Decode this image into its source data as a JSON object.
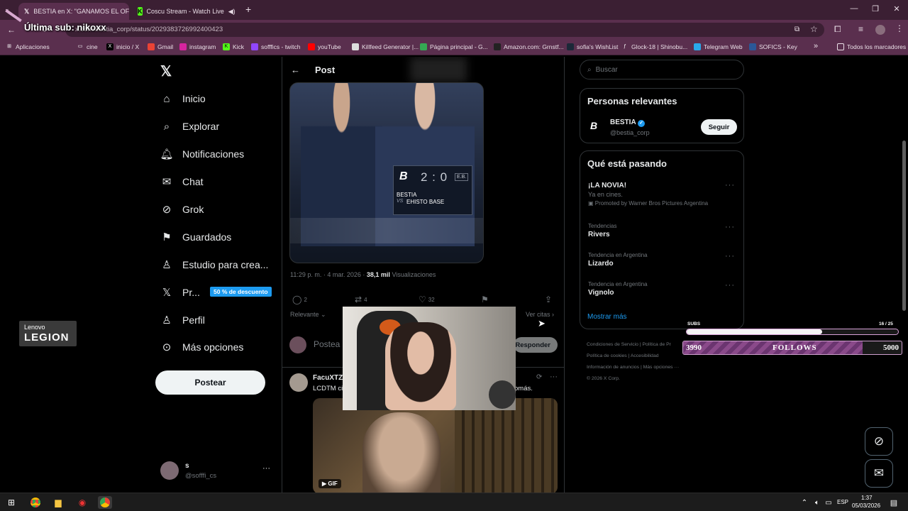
{
  "browser": {
    "tabs": [
      {
        "label": "BESTIA en X: \"GANAMOS EL OF",
        "icon": "x-logo-icon",
        "active": true
      },
      {
        "label": "Coscu Stream - Watch Live",
        "icon": "kick-logo-icon",
        "active": false
      }
    ],
    "new_tab": "+",
    "url": "x.com/bestia_corp/status/2029383726992400423",
    "bookmarks": [
      {
        "label": "Aplicaciones",
        "icon": "apps-grid-icon"
      },
      {
        "label": "cine",
        "icon": "folder-icon"
      },
      {
        "label": "inicio / X",
        "icon": "x-logo-icon"
      },
      {
        "label": "Gmail",
        "icon": "gmail-icon"
      },
      {
        "label": "instagram",
        "icon": "instagram-icon"
      },
      {
        "label": "Kick",
        "icon": "kick-logo-icon"
      },
      {
        "label": "sofffics - twitch",
        "icon": "twitch-icon"
      },
      {
        "label": "youTube",
        "icon": "youtube-icon"
      },
      {
        "label": "Killfeed Generator |...",
        "icon": "killfeed-icon"
      },
      {
        "label": "Página principal - G...",
        "icon": "drive-icon"
      },
      {
        "label": "Amazon.com: Grnstf...",
        "icon": "amazon-icon"
      },
      {
        "label": "sofia's WishList",
        "icon": "steam-icon"
      },
      {
        "label": "Glock-18 | Shinobu...",
        "icon": "function-icon"
      },
      {
        "label": "Telegram Web",
        "icon": "telegram-icon"
      },
      {
        "label": "SOFICS - Key",
        "icon": "doc-icon"
      }
    ],
    "all_bookmarks": "Todos los marcadores",
    "overflow": "»"
  },
  "stream_overlay": {
    "last_sub": "Última sub: nikoxx",
    "legion_brand": "Lenovo",
    "legion_name": "LEGION",
    "subs_label": "SUBS",
    "subs_count": "16 / 25",
    "subs_fraction": 0.64,
    "follows_start": "3990",
    "follows_label": "FOLLOWS",
    "follows_goal": "5000",
    "follows_fraction": 0.82
  },
  "nav": {
    "items": [
      {
        "label": "Inicio",
        "icon": "home-icon"
      },
      {
        "label": "Explorar",
        "icon": "search-icon"
      },
      {
        "label": "Notificaciones",
        "icon": "bell-icon"
      },
      {
        "label": "Chat",
        "icon": "mail-icon"
      },
      {
        "label": "Grok",
        "icon": "grok-icon"
      },
      {
        "label": "Guardados",
        "icon": "bookmark-icon"
      },
      {
        "label": "Estudio para crea...",
        "icon": "flask-icon"
      },
      {
        "label": "Pr...",
        "icon": "x-premium-icon"
      },
      {
        "label": "Perfil",
        "icon": "person-icon"
      },
      {
        "label": "Más opciones",
        "icon": "more-circle-icon"
      }
    ],
    "promo_badge": "50 % de descuento",
    "post_button": "Postear",
    "account_name": "s",
    "account_handle": "@sofffi_cs",
    "account_more": "···"
  },
  "post": {
    "header": "Post",
    "scoreboard_score": "2 : 0",
    "scoreboard_team1": "BESTIA",
    "scoreboard_vs": "VS",
    "scoreboard_team2": "EHISTO BASE",
    "scoreboard_tag": "E.B.",
    "timestamp": "11:29 p. m. · 4 mar. 2026 ·",
    "views_count": "38,1 mil",
    "views_label": "Visualizaciones",
    "replies": "2",
    "reposts": "4",
    "likes": "32",
    "sort": "Relevante",
    "quotes": "Ver citas",
    "reply_placeholder": "Postea",
    "reply_button": "Responder"
  },
  "reply": {
    "author": "FacuXTZ",
    "text_start": "LCDTM ci",
    "text_end": "omás.",
    "gif_label": "GIF"
  },
  "sidebar": {
    "search_placeholder": "Buscar",
    "relevant_title": "Personas relevantes",
    "relevant_name": "BESTIA",
    "relevant_handle": "@bestia_corp",
    "follow_button": "Seguir",
    "trending_title": "Qué está pasando",
    "trends": [
      {
        "category": "",
        "name": "¡LA NOVIA!",
        "sub": "Ya en cines.",
        "promo": "Promoted by Warner Bros Pictures Argentina"
      },
      {
        "category": "Tendencias",
        "name": "Rivers"
      },
      {
        "category": "Tendencia en Argentina",
        "name": "Lizardo"
      },
      {
        "category": "Tendencia en Argentina",
        "name": "Vignolo"
      }
    ],
    "show_more": "Mostrar más",
    "footer": [
      "Condiciones de Servicio",
      "Política de Pr",
      "Política de cookies",
      "Accesibilidad",
      "Información de anuncios",
      "Más opciones ···",
      "© 2026 X Corp."
    ]
  },
  "taskbar": {
    "lang": "ESP",
    "time": "1:37",
    "date": "05/03/2026"
  },
  "colors": {
    "chrome_dark": "#3b1f33",
    "chrome_mid": "#5a2f4e",
    "x_blue": "#1d9bf0",
    "follows_purple": "#7a3a7a"
  }
}
